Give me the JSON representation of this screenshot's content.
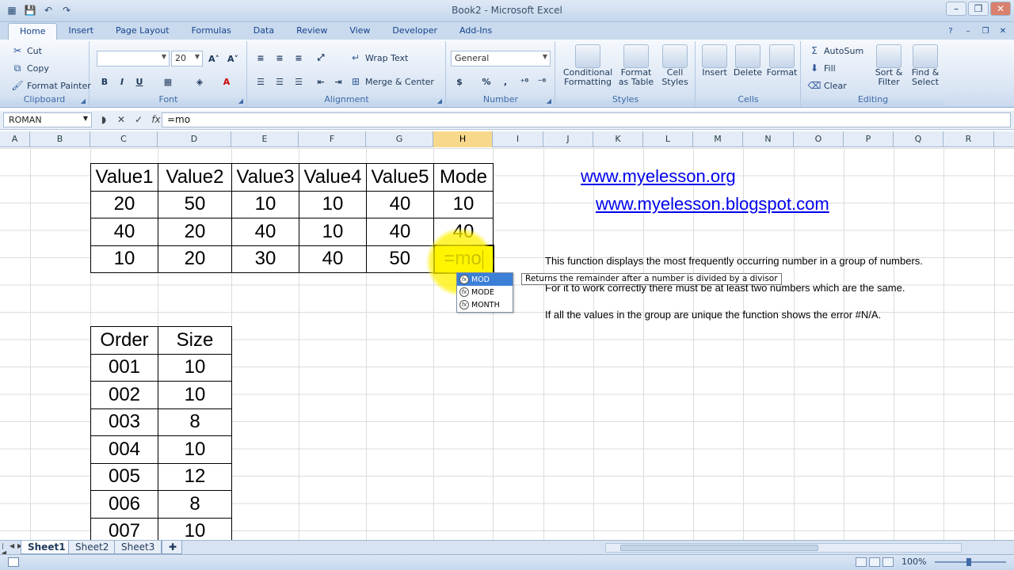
{
  "window": {
    "title": "Book2 - Microsoft Excel",
    "qat_icons": [
      "excel-logo-icon",
      "save-icon",
      "undo-icon",
      "redo-icon"
    ],
    "controls": [
      "minimize-icon",
      "restore-icon",
      "close-icon"
    ]
  },
  "ribbon": {
    "tabs": [
      "Home",
      "Insert",
      "Page Layout",
      "Formulas",
      "Data",
      "Review",
      "View",
      "Developer",
      "Add-Ins"
    ],
    "active_tab": "Home",
    "clipboard": {
      "cut": "Cut",
      "copy": "Copy",
      "format_painter": "Format Painter",
      "label": "Clipboard"
    },
    "font": {
      "name": "",
      "size": "20",
      "bold": "B",
      "italic": "I",
      "underline": "U",
      "label": "Font"
    },
    "alignment": {
      "wrap_text": "Wrap Text",
      "merge_center": "Merge & Center",
      "label": "Alignment"
    },
    "number": {
      "format": "General",
      "currency": "$",
      "percent": "%",
      "comma": ",",
      "label": "Number"
    },
    "styles": {
      "conditional": "Conditional Formatting",
      "format_table": "Format as Table",
      "cell_styles": "Cell Styles",
      "label": "Styles"
    },
    "cells": {
      "insert": "Insert",
      "delete": "Delete",
      "format": "Format",
      "label": "Cells"
    },
    "editing": {
      "autosum": "AutoSum",
      "fill": "Fill",
      "clear": "Clear",
      "sort_filter": "Sort & Filter",
      "find_select": "Find & Select",
      "label": "Editing"
    }
  },
  "formula_bar": {
    "name_box": "ROMAN",
    "formula": "=mo",
    "fx": "fx"
  },
  "columns": [
    "A",
    "B",
    "C",
    "D",
    "E",
    "F",
    "G",
    "H",
    "I",
    "J",
    "K",
    "L",
    "M",
    "N",
    "O",
    "P",
    "Q",
    "R"
  ],
  "selected_column": "H",
  "table1": {
    "headers": [
      "Value1",
      "Value2",
      "Value3",
      "Value4",
      "Value5",
      "Mode"
    ],
    "rows": [
      [
        "20",
        "50",
        "10",
        "10",
        "40",
        "10"
      ],
      [
        "40",
        "20",
        "40",
        "10",
        "40",
        "40"
      ],
      [
        "10",
        "20",
        "30",
        "40",
        "50",
        "=mo"
      ]
    ]
  },
  "table2": {
    "headers": [
      "Order",
      "Size"
    ],
    "rows": [
      [
        "001",
        "10"
      ],
      [
        "002",
        "10"
      ],
      [
        "003",
        "8"
      ],
      [
        "004",
        "10"
      ],
      [
        "005",
        "12"
      ],
      [
        "006",
        "8"
      ],
      [
        "007",
        "10"
      ]
    ]
  },
  "links": [
    "www.myelesson.org",
    "www.myelesson.blogspot.com"
  ],
  "notes": [
    "This function displays the most frequently occurring number in a group of numbers.",
    "For it to work correctly there must be at least two numbers which are the same.",
    "If all the values in the group are unique the function shows the error #N/A."
  ],
  "autocomplete": {
    "items": [
      "MOD",
      "MODE",
      "MONTH"
    ],
    "selected": "MOD",
    "tooltip": "Returns the remainder after a number is divided by a divisor"
  },
  "sheets": [
    "Sheet1",
    "Sheet2",
    "Sheet3"
  ],
  "active_sheet": "Sheet1",
  "status": {
    "zoom": "100%"
  },
  "colors": {
    "highlight": "#ffff00",
    "link": "#0000ee",
    "ribbon": "#dbe6f4"
  }
}
